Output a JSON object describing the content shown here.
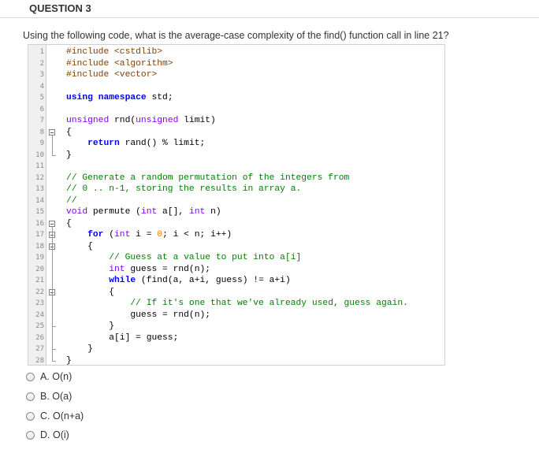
{
  "question": {
    "title": "QUESTION 3",
    "text": "Using the following code, what is the average-case complexity of the find() function call in line 21?"
  },
  "code_lines": [
    "#include <cstdlib>",
    "#include <algorithm>",
    "#include <vector>",
    "",
    "using namespace std;",
    "",
    "unsigned rnd(unsigned limit)",
    "{",
    "    return rand() % limit;",
    "}",
    "",
    "// Generate a random permutation of the integers from",
    "// 0 .. n-1, storing the results in array a.",
    "//",
    "void permute (int a[], int n)",
    "{",
    "    for (int i = 0; i < n; i++)",
    "    {",
    "        // Guess at a value to put into a[i]",
    "        int guess = rnd(n);",
    "        while (find(a, a+i, guess) != a+i)",
    "        {",
    "            // If it's one that we've already used, guess again.",
    "            guess = rnd(n);",
    "        }",
    "        a[i] = guess;",
    "    }",
    "}"
  ],
  "options": [
    {
      "label": "A. O(n)"
    },
    {
      "label": "B. O(a)"
    },
    {
      "label": "C. O(n+a)"
    },
    {
      "label": "D. O(i)"
    }
  ]
}
